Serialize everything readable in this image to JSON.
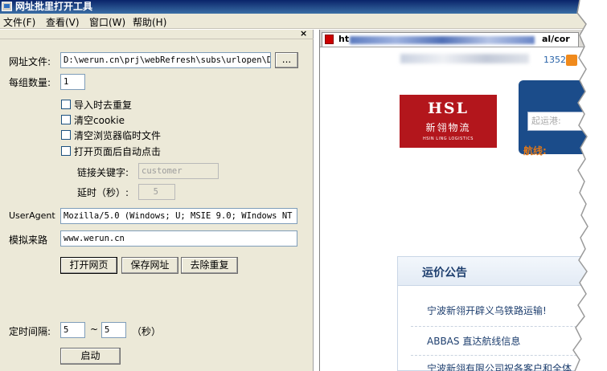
{
  "window": {
    "title": "网址批里打开工具"
  },
  "menu": [
    "文件(F)",
    "查看(V)",
    "窗口(W)",
    "帮助(H)"
  ],
  "form": {
    "url_file_label": "网址文件:",
    "url_file_value": "D:\\werun.cn\\prj\\webRefresh\\subs\\urlopen\\Deb",
    "browse_label": "...",
    "group_count_label": "每组数量:",
    "group_count_value": "1",
    "checkboxes": [
      {
        "label": "导入时去重复",
        "checked": false
      },
      {
        "label": "清空cookie",
        "checked": false
      },
      {
        "label": "清空浏览器临时文件",
        "checked": false
      },
      {
        "label": "打开页面后自动点击",
        "checked": false
      }
    ],
    "link_keyword_label": "链接关键字:",
    "link_keyword_value": "customer",
    "delay_label": "延时（秒）:",
    "delay_value": "5",
    "useragent_label": "UserAgent",
    "useragent_value": "Mozilla/5.0 (Windows; U; MSIE 9.0; WIndows NT 9.0",
    "referer_label": "模拟来路",
    "referer_value": "www.werun.cn",
    "btn_open": "打开网页",
    "btn_save": "保存网址",
    "btn_dedupe": "去除重复",
    "interval_label": "定时间隔:",
    "interval_from": "5",
    "interval_tilde": "~",
    "interval_to": "5",
    "interval_unit": "（秒）",
    "btn_start": "启动"
  },
  "browser": {
    "tab_text_start": "ht",
    "tab_text_end": "al/cor",
    "phone_partial": "1352",
    "logo_main": "HSL",
    "logo_cn": "新翎物流",
    "logo_en": "HSIN LING LOGISTICS",
    "search_placeholder": "起运港:",
    "route_label": "航线:",
    "notice_title": "运价公告",
    "notice_items": [
      "宁波新翎开辟义乌铁路运输!",
      "ABBAS 直达航线信息",
      "宁波新翎有限公司祝各客户和全体"
    ]
  },
  "colors": {
    "titlebar": "#0a246a",
    "panel": "#ece9d8",
    "logo_red": "#b3161c",
    "accent_orange": "#e0781a",
    "navy": "#1b4c8a"
  }
}
